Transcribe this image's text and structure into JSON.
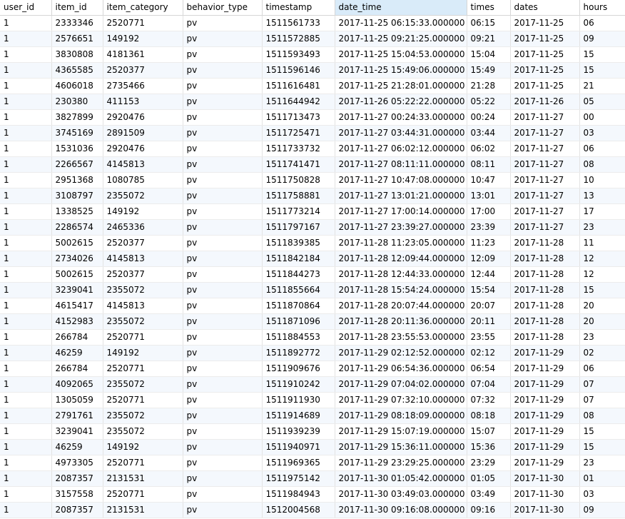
{
  "columns": [
    "user_id",
    "item_id",
    "item_category",
    "behavior_type",
    "timestamp",
    "date_time",
    "times",
    "dates",
    "hours"
  ],
  "sorted_column": "date_time",
  "rows": [
    [
      "1",
      "2333346",
      "2520771",
      "pv",
      "1511561733",
      "2017-11-25 06:15:33.000000",
      "06:15",
      "2017-11-25",
      "06"
    ],
    [
      "1",
      "2576651",
      "149192",
      "pv",
      "1511572885",
      "2017-11-25 09:21:25.000000",
      "09:21",
      "2017-11-25",
      "09"
    ],
    [
      "1",
      "3830808",
      "4181361",
      "pv",
      "1511593493",
      "2017-11-25 15:04:53.000000",
      "15:04",
      "2017-11-25",
      "15"
    ],
    [
      "1",
      "4365585",
      "2520377",
      "pv",
      "1511596146",
      "2017-11-25 15:49:06.000000",
      "15:49",
      "2017-11-25",
      "15"
    ],
    [
      "1",
      "4606018",
      "2735466",
      "pv",
      "1511616481",
      "2017-11-25 21:28:01.000000",
      "21:28",
      "2017-11-25",
      "21"
    ],
    [
      "1",
      "230380",
      "411153",
      "pv",
      "1511644942",
      "2017-11-26 05:22:22.000000",
      "05:22",
      "2017-11-26",
      "05"
    ],
    [
      "1",
      "3827899",
      "2920476",
      "pv",
      "1511713473",
      "2017-11-27 00:24:33.000000",
      "00:24",
      "2017-11-27",
      "00"
    ],
    [
      "1",
      "3745169",
      "2891509",
      "pv",
      "1511725471",
      "2017-11-27 03:44:31.000000",
      "03:44",
      "2017-11-27",
      "03"
    ],
    [
      "1",
      "1531036",
      "2920476",
      "pv",
      "1511733732",
      "2017-11-27 06:02:12.000000",
      "06:02",
      "2017-11-27",
      "06"
    ],
    [
      "1",
      "2266567",
      "4145813",
      "pv",
      "1511741471",
      "2017-11-27 08:11:11.000000",
      "08:11",
      "2017-11-27",
      "08"
    ],
    [
      "1",
      "2951368",
      "1080785",
      "pv",
      "1511750828",
      "2017-11-27 10:47:08.000000",
      "10:47",
      "2017-11-27",
      "10"
    ],
    [
      "1",
      "3108797",
      "2355072",
      "pv",
      "1511758881",
      "2017-11-27 13:01:21.000000",
      "13:01",
      "2017-11-27",
      "13"
    ],
    [
      "1",
      "1338525",
      "149192",
      "pv",
      "1511773214",
      "2017-11-27 17:00:14.000000",
      "17:00",
      "2017-11-27",
      "17"
    ],
    [
      "1",
      "2286574",
      "2465336",
      "pv",
      "1511797167",
      "2017-11-27 23:39:27.000000",
      "23:39",
      "2017-11-27",
      "23"
    ],
    [
      "1",
      "5002615",
      "2520377",
      "pv",
      "1511839385",
      "2017-11-28 11:23:05.000000",
      "11:23",
      "2017-11-28",
      "11"
    ],
    [
      "1",
      "2734026",
      "4145813",
      "pv",
      "1511842184",
      "2017-11-28 12:09:44.000000",
      "12:09",
      "2017-11-28",
      "12"
    ],
    [
      "1",
      "5002615",
      "2520377",
      "pv",
      "1511844273",
      "2017-11-28 12:44:33.000000",
      "12:44",
      "2017-11-28",
      "12"
    ],
    [
      "1",
      "3239041",
      "2355072",
      "pv",
      "1511855664",
      "2017-11-28 15:54:24.000000",
      "15:54",
      "2017-11-28",
      "15"
    ],
    [
      "1",
      "4615417",
      "4145813",
      "pv",
      "1511870864",
      "2017-11-28 20:07:44.000000",
      "20:07",
      "2017-11-28",
      "20"
    ],
    [
      "1",
      "4152983",
      "2355072",
      "pv",
      "1511871096",
      "2017-11-28 20:11:36.000000",
      "20:11",
      "2017-11-28",
      "20"
    ],
    [
      "1",
      "266784",
      "2520771",
      "pv",
      "1511884553",
      "2017-11-28 23:55:53.000000",
      "23:55",
      "2017-11-28",
      "23"
    ],
    [
      "1",
      "46259",
      "149192",
      "pv",
      "1511892772",
      "2017-11-29 02:12:52.000000",
      "02:12",
      "2017-11-29",
      "02"
    ],
    [
      "1",
      "266784",
      "2520771",
      "pv",
      "1511909676",
      "2017-11-29 06:54:36.000000",
      "06:54",
      "2017-11-29",
      "06"
    ],
    [
      "1",
      "4092065",
      "2355072",
      "pv",
      "1511910242",
      "2017-11-29 07:04:02.000000",
      "07:04",
      "2017-11-29",
      "07"
    ],
    [
      "1",
      "1305059",
      "2520771",
      "pv",
      "1511911930",
      "2017-11-29 07:32:10.000000",
      "07:32",
      "2017-11-29",
      "07"
    ],
    [
      "1",
      "2791761",
      "2355072",
      "pv",
      "1511914689",
      "2017-11-29 08:18:09.000000",
      "08:18",
      "2017-11-29",
      "08"
    ],
    [
      "1",
      "3239041",
      "2355072",
      "pv",
      "1511939239",
      "2017-11-29 15:07:19.000000",
      "15:07",
      "2017-11-29",
      "15"
    ],
    [
      "1",
      "46259",
      "149192",
      "pv",
      "1511940971",
      "2017-11-29 15:36:11.000000",
      "15:36",
      "2017-11-29",
      "15"
    ],
    [
      "1",
      "4973305",
      "2520771",
      "pv",
      "1511969365",
      "2017-11-29 23:29:25.000000",
      "23:29",
      "2017-11-29",
      "23"
    ],
    [
      "1",
      "2087357",
      "2131531",
      "pv",
      "1511975142",
      "2017-11-30 01:05:42.000000",
      "01:05",
      "2017-11-30",
      "01"
    ],
    [
      "1",
      "3157558",
      "2520771",
      "pv",
      "1511984943",
      "2017-11-30 03:49:03.000000",
      "03:49",
      "2017-11-30",
      "03"
    ],
    [
      "1",
      "2087357",
      "2131531",
      "pv",
      "1512004568",
      "2017-11-30 09:16:08.000000",
      "09:16",
      "2017-11-30",
      "09"
    ]
  ]
}
